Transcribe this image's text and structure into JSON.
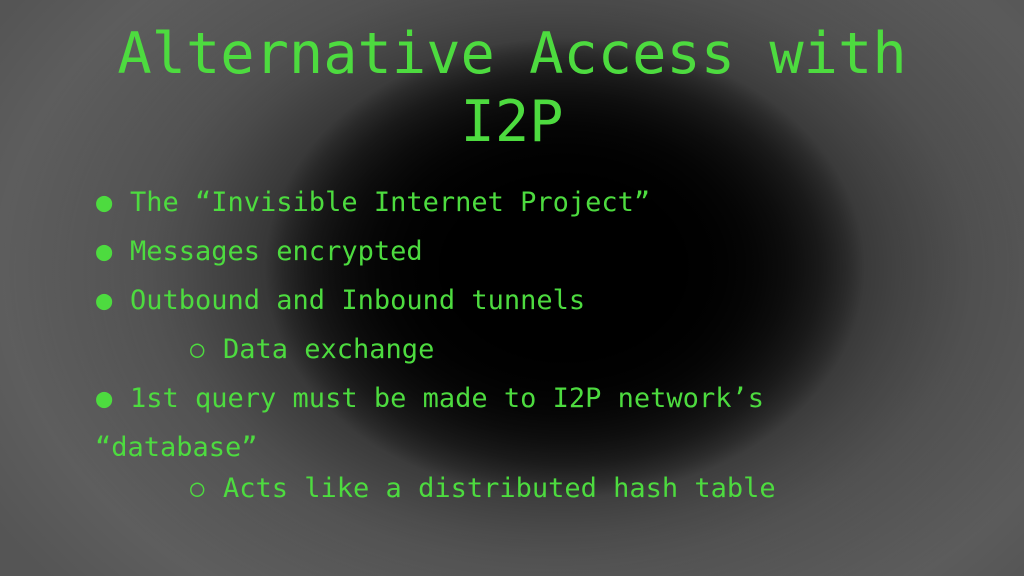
{
  "slide": {
    "title": "Alternative Access with\nI2P",
    "title_line1": "Alternative Access with",
    "title_line2": "I2P",
    "accent_color": "#4ddb3f",
    "background_edge_color": "#8d8d8d",
    "background_center_color": "#000000",
    "bullet_marker": "●",
    "sub_bullet_marker": "○",
    "items": [
      {
        "level": 1,
        "marker": "●",
        "text": "The “Invisible Internet Project”"
      },
      {
        "level": 1,
        "marker": "●",
        "text": "Messages encrypted"
      },
      {
        "level": 1,
        "marker": "●",
        "text": "Outbound and Inbound tunnels"
      },
      {
        "level": 2,
        "marker": "○",
        "text": "Data exchange"
      },
      {
        "level": 1,
        "marker": "●",
        "text": "1st query must be made to I2P network’s"
      },
      {
        "level": 0,
        "marker": "",
        "text": "“database”"
      },
      {
        "level": 2,
        "marker": "○",
        "text": "Acts like a distributed hash table"
      }
    ]
  }
}
